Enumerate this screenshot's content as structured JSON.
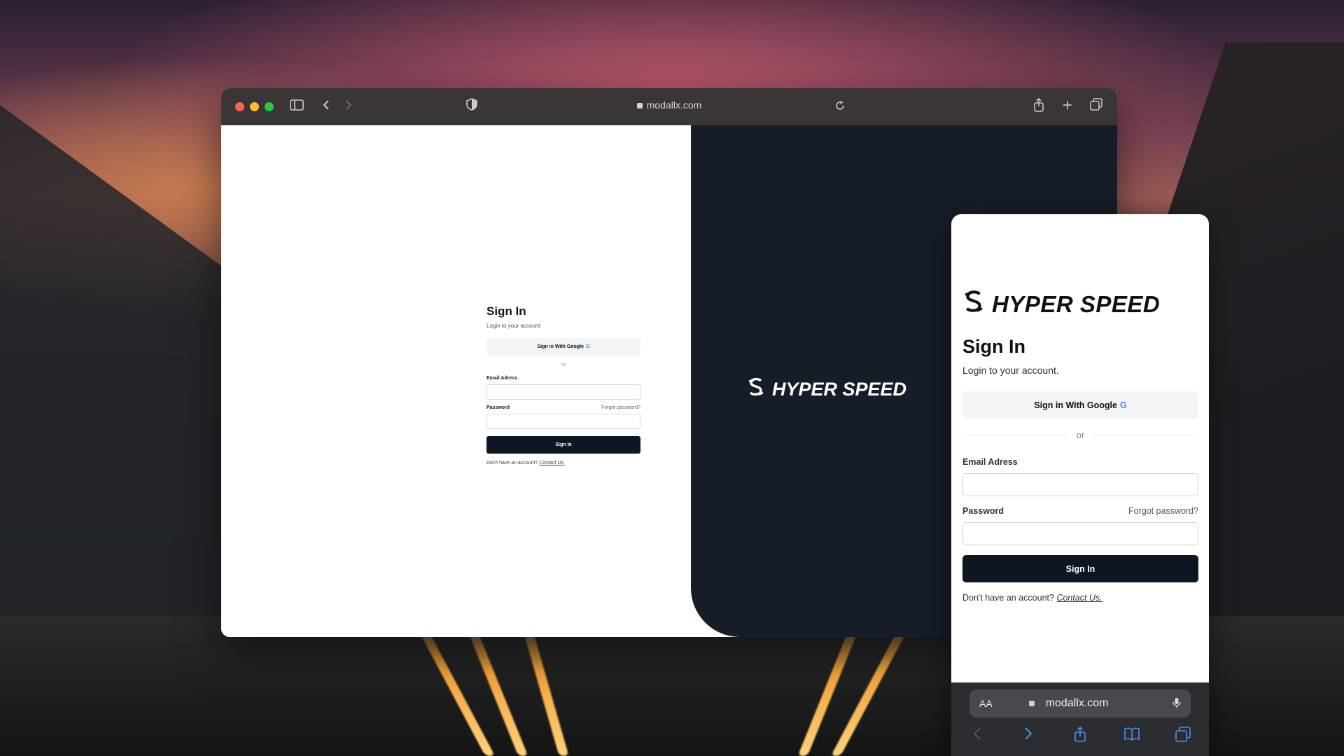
{
  "browser": {
    "url": "modallx.com",
    "icons": {
      "sidebar": "sidebar-icon",
      "back": "chevron-left-icon",
      "forward": "chevron-right-icon",
      "privacy": "shield-icon",
      "reload": "reload-icon",
      "share": "share-icon",
      "new_tab": "plus-icon",
      "tabs": "tabs-icon"
    },
    "traffic_lights": [
      "#fe5f57",
      "#febc2e",
      "#28c840"
    ]
  },
  "desktop_page": {
    "title": "Sign In",
    "subtitle": "Login to your account.",
    "google_button": "Sign in With Google",
    "google_glyph": "G",
    "or_text": "or",
    "email_label": "Email Adress",
    "password_label": "Password",
    "forgot_password": "Forgot password?",
    "sign_in_button": "Sign In",
    "footer_text": "Don't have an account?",
    "contact_link": "Contact Us.",
    "brand_name": "HYPER SPEED",
    "brand_mark": "S"
  },
  "mobile_page": {
    "brand_name": "HYPER SPEED",
    "brand_mark": "S",
    "title": "Sign In",
    "subtitle": "Login to your account.",
    "google_button": "Sign in With Google",
    "google_glyph": "G",
    "or_text": "or",
    "email_label": "Email Adress",
    "password_label": "Password",
    "forgot_password": "Forgot password?",
    "sign_in_button": "Sign In",
    "footer_text": "Don't have an account?",
    "contact_link": "Contact Us.",
    "url": "modallx.com",
    "aa_label": "AA"
  },
  "colors": {
    "dark_panel": "#161c28",
    "primary_button": "#0f1623",
    "link_blue": "#4a90e8"
  }
}
